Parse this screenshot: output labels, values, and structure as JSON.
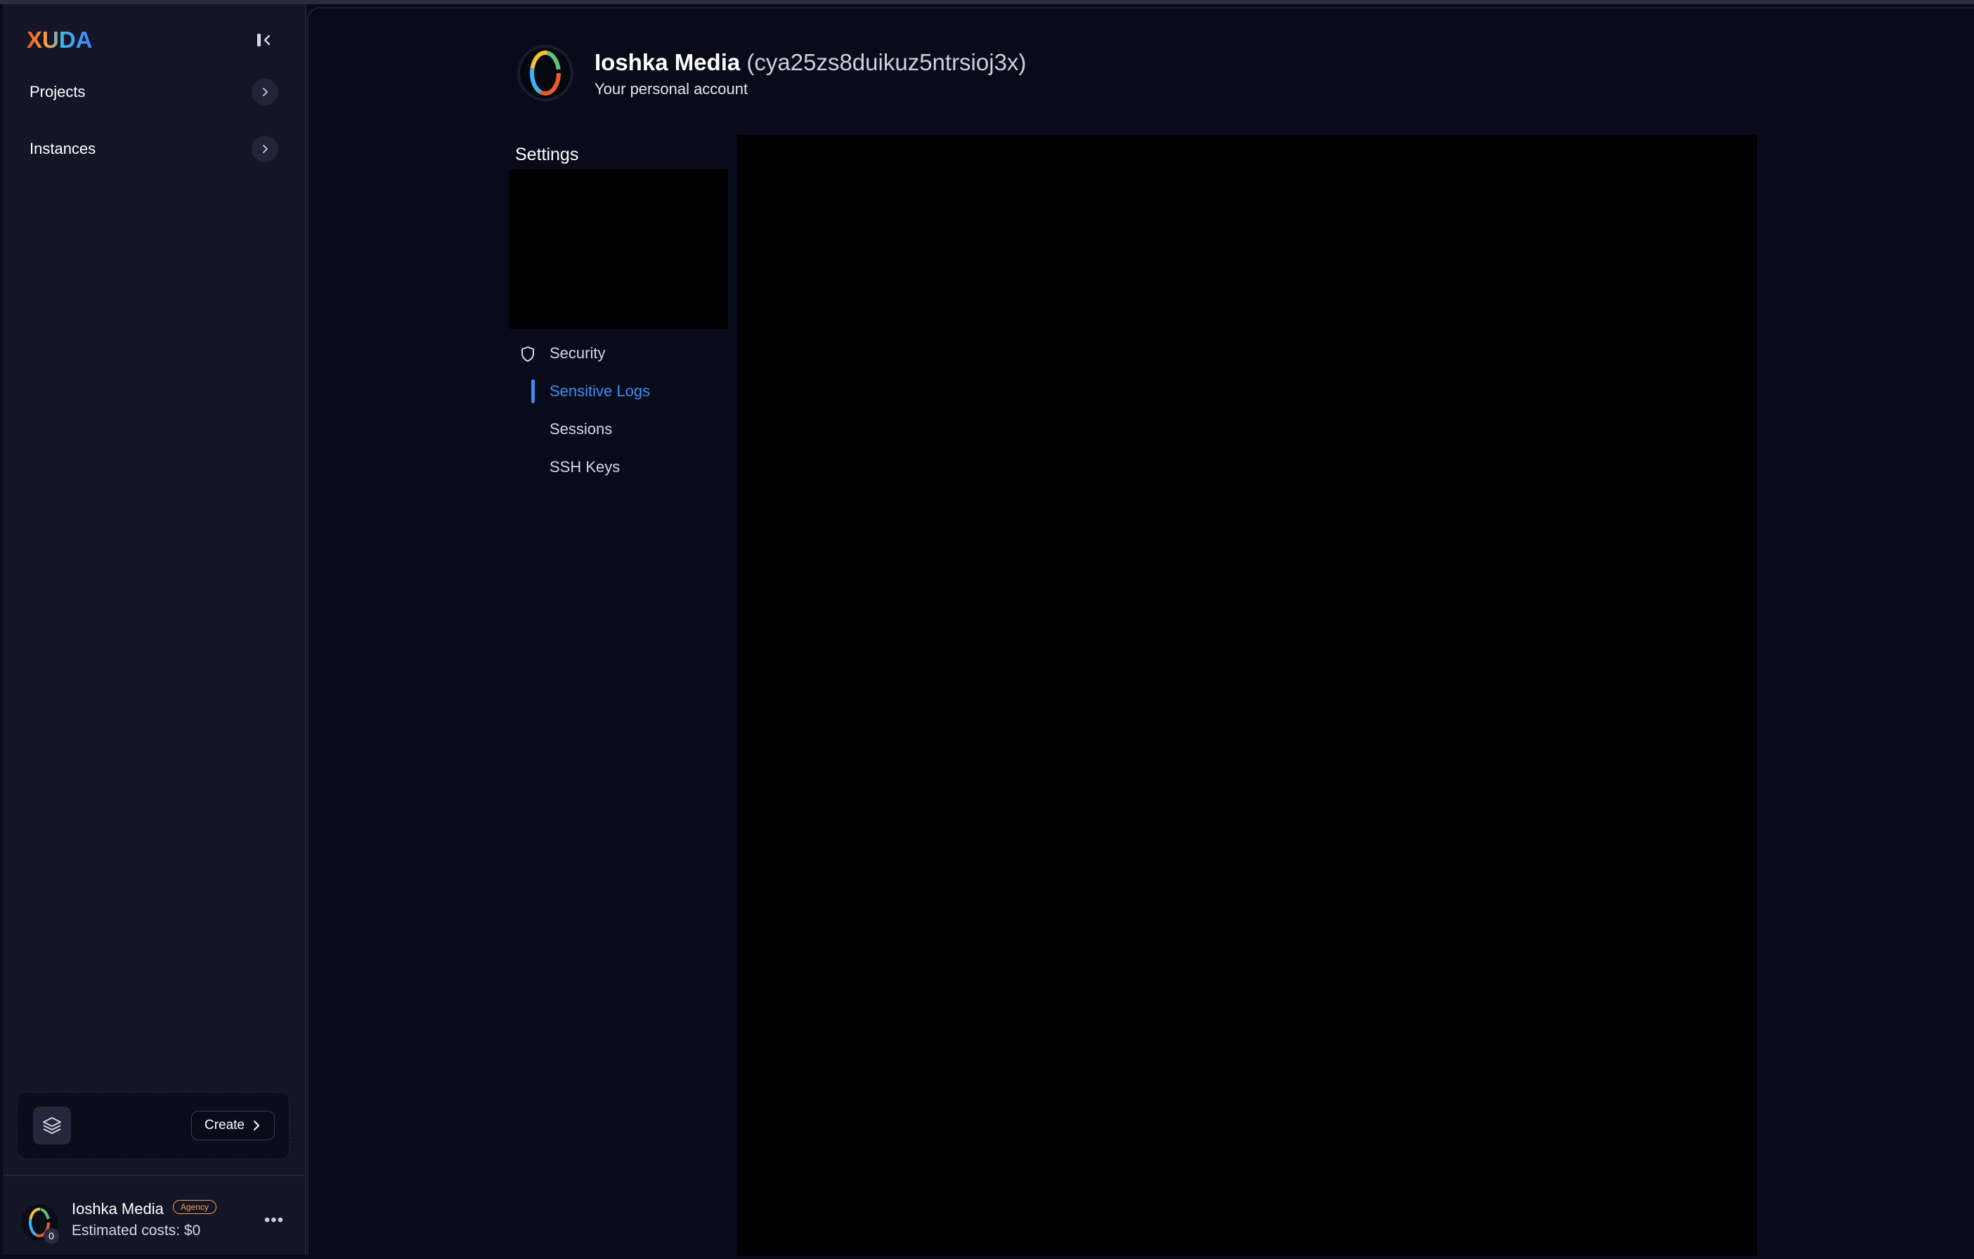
{
  "app": {
    "logo_text": "XUDA"
  },
  "sidebar": {
    "items": [
      {
        "label": "Projects"
      },
      {
        "label": "Instances"
      }
    ],
    "create_label": "Create",
    "account": {
      "name": "Ioshka Media",
      "badge": "Agency",
      "cost": "Estimated costs: $0",
      "count": "0"
    }
  },
  "header": {
    "name": "Ioshka Media",
    "id": "(cya25zs8duikuz5ntrsioj3x)",
    "subtitle": "Your personal account"
  },
  "settings": {
    "title": "Settings",
    "items": [
      {
        "label": "Security",
        "icon": "shield-icon"
      },
      {
        "label": "Sensitive Logs",
        "active": true
      },
      {
        "label": "Sessions"
      },
      {
        "label": "SSH Keys"
      }
    ]
  },
  "colors": {
    "accent": "#3c8ff0",
    "badge": "#f0a64a",
    "background": "#0a0b18",
    "sidebar": "#141527"
  }
}
